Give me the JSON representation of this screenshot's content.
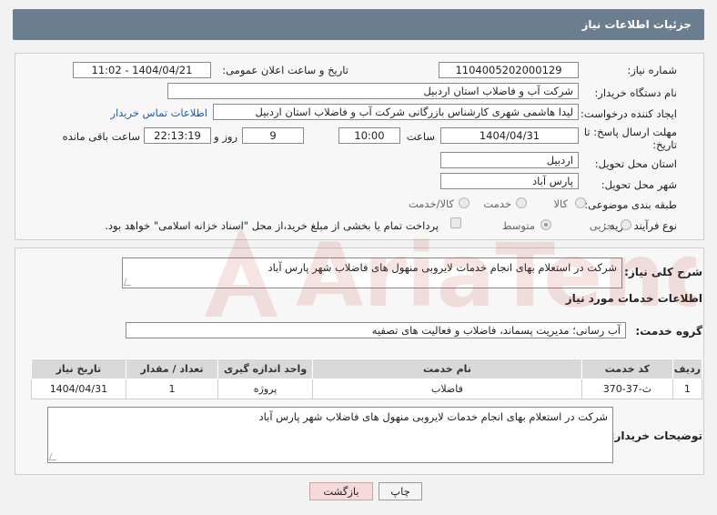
{
  "header": {
    "title": "جزئیات اطلاعات نیاز"
  },
  "form": {
    "need_number": {
      "label": "شماره نیاز:",
      "value": "1104005202000129"
    },
    "announce_datetime": {
      "label": "تاریخ و ساعت اعلان عمومی:",
      "value": "1404/04/21 - 11:02"
    },
    "buyer_org": {
      "label": "نام دستگاه خریدار:",
      "value": "شرکت آب و فاضلاب استان اردبیل"
    },
    "requester": {
      "label": "ایجاد کننده درخواست:",
      "value": "لیدا  هاشمی شهری کارشناس بازرگانی شرکت آب و فاضلاب استان اردبیل",
      "contact_link": "اطلاعات تماس خریدار"
    },
    "deadline": {
      "label": "مهلت ارسال پاسخ: تا تاریخ:",
      "date": "1404/04/31",
      "time_label": "ساعت",
      "time": "10:00",
      "days": "9",
      "days_label": "روز و",
      "remaining": "22:13:19",
      "remaining_label": "ساعت باقی مانده"
    },
    "province": {
      "label": "استان محل تحویل:",
      "value": "اردبیل"
    },
    "city": {
      "label": "شهر محل تحویل:",
      "value": "پارس آباد"
    },
    "category": {
      "label": "طبقه بندی موضوعی:",
      "options": [
        "کالا",
        "خدمت",
        "کالا/خدمت"
      ]
    },
    "process_type": {
      "label": "نوع فرآیند خرید :",
      "options": [
        "جزیی",
        "متوسط"
      ],
      "payment_note": "پرداخت تمام یا بخشی از مبلغ خرید،از محل \"اسناد خزانه اسلامی\" خواهد بود."
    }
  },
  "summary": {
    "label": "شرح کلی نیاز:",
    "value": "شرکت در استعلام بهای انجام خدمات لایروبی منهول های فاضلاب شهر پارس آباد"
  },
  "services": {
    "section_title": "اطلاعات خدمات مورد نیاز",
    "group_label": "گروه خدمت:",
    "group_value": "آب رسانی؛ مدیریت پسماند، فاضلاب و فعالیت های تصفیه",
    "columns": [
      "ردیف",
      "کد خدمت",
      "نام خدمت",
      "واحد اندازه گیری",
      "تعداد / مقدار",
      "تاریخ نیاز"
    ],
    "rows": [
      [
        "1",
        "ث-37-370",
        "فاضلاب",
        "پروژه",
        "1",
        "1404/04/31"
      ]
    ]
  },
  "buyer_notes": {
    "label": "توضیحات خریدار:",
    "value": "شرکت در استعلام بهای انجام خدمات لایروبی منهول های فاضلاب شهر پارس آباد"
  },
  "buttons": {
    "print": "چاپ",
    "back": "بازگشت"
  },
  "watermark": {
    "text": "AriaTender.net"
  },
  "colors": {
    "header_bg": "#6a7e8f",
    "link": "#1a5fb4",
    "back_button": "#f6d9d9",
    "watermark": "#c0392b"
  }
}
